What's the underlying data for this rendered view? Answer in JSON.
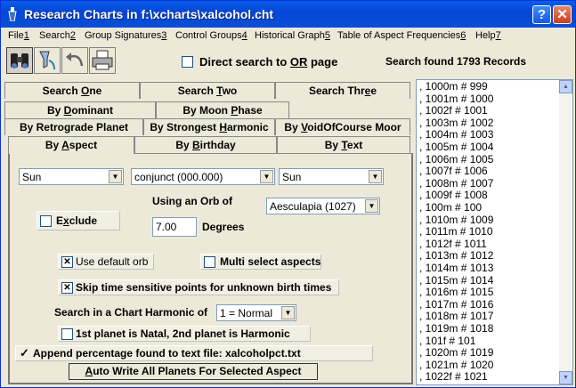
{
  "window": {
    "title": "Research Charts in f:\\xcharts\\xalcohol.cht"
  },
  "menu": [
    {
      "label": "File",
      "accel": "1"
    },
    {
      "label": "Search",
      "accel": "2"
    },
    {
      "label": "Group Signatures",
      "accel": "3"
    },
    {
      "label": "Control Groups",
      "accel": "4"
    },
    {
      "label": "Historical Graph",
      "accel": "5"
    },
    {
      "label": "Table of Aspect Frequencies",
      "accel": "6"
    },
    {
      "label": "Help",
      "accel": "7"
    }
  ],
  "toolbar": {
    "direct_search": {
      "pre": "Direct search to ",
      "u": "OR",
      "post": " page",
      "checked": false
    },
    "found_text": "Search found 1793 Records"
  },
  "tabs": {
    "row1": [
      {
        "pre": "Search ",
        "u": "O",
        "post": "ne"
      },
      {
        "pre": "Search ",
        "u": "T",
        "post": "wo"
      },
      {
        "pre": "Search Thr",
        "u": "e",
        "post": "e"
      }
    ],
    "row2": [
      {
        "pre": "By ",
        "u": "D",
        "post": "ominant"
      },
      {
        "pre": "By Moon ",
        "u": "P",
        "post": "hase"
      }
    ],
    "row3": [
      {
        "pre": "By Retrograde Planet",
        "u": "",
        "post": ""
      },
      {
        "pre": "By Strongest ",
        "u": "H",
        "post": "armonic"
      },
      {
        "pre": "By ",
        "u": "V",
        "post": "oidOfCourse Moor"
      }
    ],
    "row4": [
      {
        "pre": "By ",
        "u": "A",
        "post": "spect"
      },
      {
        "pre": "By ",
        "u": "B",
        "post": "irthday"
      },
      {
        "pre": "By ",
        "u": "T",
        "post": "ext"
      }
    ]
  },
  "form": {
    "planet1": "Sun",
    "aspect": "conjunct (000.000)",
    "planet2": "Sun",
    "orb_label": "Using an Orb of",
    "exclude": {
      "pre": "E",
      "u": "x",
      "post": "clude"
    },
    "orb_value": "7.00",
    "degrees_label": "Degrees",
    "asteroid": "Aesculapia (1027)",
    "use_default_orb": {
      "label": "Use default orb",
      "checked": true
    },
    "multi_select": {
      "label": "Multi select aspects",
      "checked": false
    },
    "skip_time": {
      "label": "Skip time sensitive points for unknown birth times",
      "checked": true
    },
    "harmonic_label": "Search in a Chart Harmonic of",
    "harmonic_value": "1 = Normal",
    "natal_harmonic": {
      "label": "1st planet is Natal, 2nd planet is Harmonic",
      "checked": false
    },
    "append_pct": {
      "label": "Append percentage found to text file: xalcoholpct.txt",
      "checked": true
    },
    "auto_write": {
      "u": "A",
      "post": "uto Write All Planets For Selected Aspect"
    }
  },
  "records": [
    ", 1000m  # 999",
    ", 1001m  # 1000",
    ", 1002f  # 1001",
    ", 1003m  # 1002",
    ", 1004m  # 1003",
    ", 1005m  # 1004",
    ", 1006m  # 1005",
    ", 1007f  # 1006",
    ", 1008m  # 1007",
    ", 1009f  # 1008",
    ", 100m  # 100",
    ", 1010m  # 1009",
    ", 1011m  # 1010",
    ", 1012f  # 1011",
    ", 1013m  # 1012",
    ", 1014m  # 1013",
    ", 1015m  # 1014",
    ", 1016m  # 1015",
    ", 1017m  # 1016",
    ", 1018m  # 1017",
    ", 1019m  # 1018",
    ", 101f  # 101",
    ", 1020m  # 1019",
    ", 1021m  # 1020",
    ", 1022f  # 1021"
  ],
  "colors": {
    "titlebar": "#0546d6",
    "face": "#ece9d8"
  }
}
